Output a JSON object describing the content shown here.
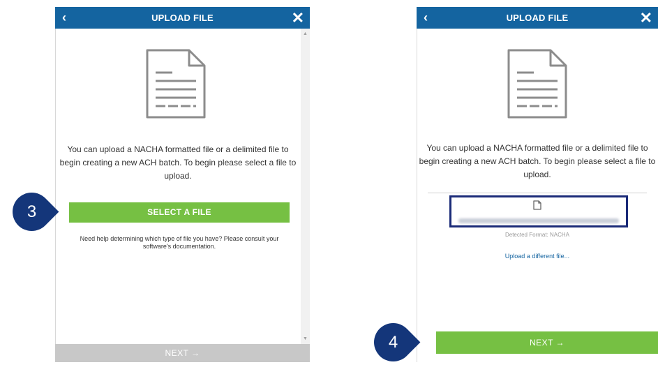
{
  "left": {
    "header": {
      "title": "UPLOAD FILE",
      "back": "‹",
      "close": "✕"
    },
    "message": [
      "You can upload a NACHA formatted file or a delimited file to",
      "begin creating a new ACH batch. To begin please select a file to",
      "upload."
    ],
    "select_button": "SELECT A FILE",
    "help": [
      "Need help determining which type of file you have? Please consult your",
      "software's documentation."
    ],
    "next": "NEXT →",
    "step": "3"
  },
  "right": {
    "header": {
      "title": "UPLOAD FILE",
      "back": "‹",
      "close": "✕"
    },
    "message": [
      "You can upload a NACHA formatted file or a delimited file to",
      "begin creating a new ACH batch. To begin please select a file to",
      "upload."
    ],
    "detected": "Detected Format: NACHA",
    "different_link": "Upload a different file...",
    "next": "NEXT →",
    "step": "4"
  },
  "colors": {
    "header": "#1464a0",
    "button": "#76c043",
    "disabled": "#c8c8c8",
    "badge": "#14367a"
  },
  "icons": [
    "document-icon",
    "file-icon"
  ]
}
